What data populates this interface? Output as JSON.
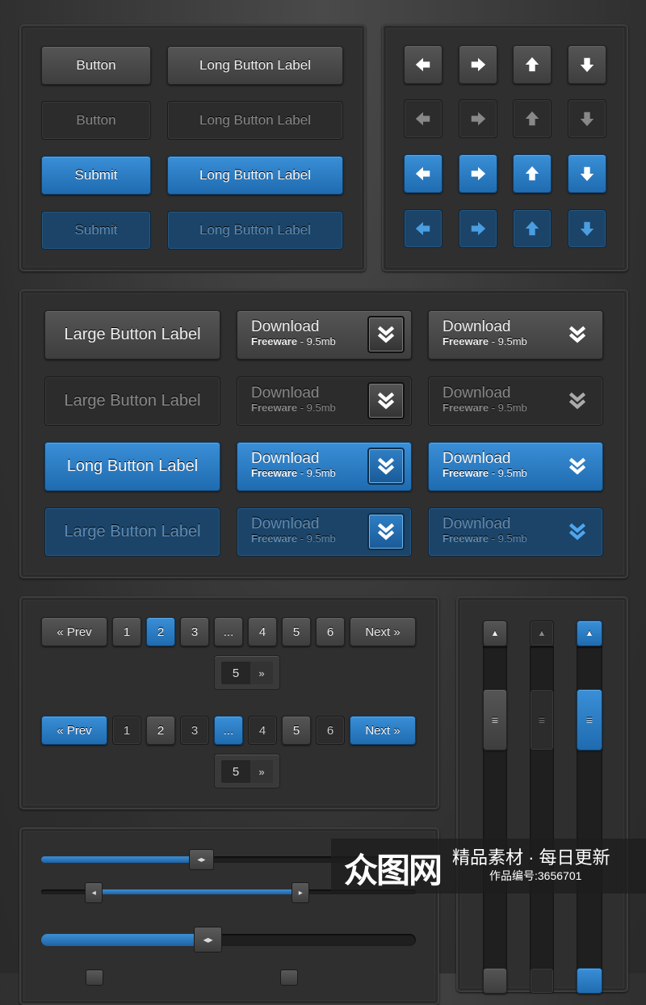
{
  "colors": {
    "accent": "#2a7cc4",
    "panel": "#2f2f2f",
    "background": "#2a2a2a"
  },
  "basic_buttons": [
    {
      "short": "Button",
      "long": "Long Button Label",
      "style": "g"
    },
    {
      "short": "Button",
      "long": "Long Button Label",
      "style": "gd"
    },
    {
      "short": "Submit",
      "long": "Long Button Label",
      "style": "b"
    },
    {
      "short": "Submit",
      "long": "Long Button Label",
      "style": "bd"
    }
  ],
  "arrow_buttons": {
    "icons": [
      "arrow-left-icon",
      "arrow-right-icon",
      "arrow-up-icon",
      "arrow-down-icon"
    ],
    "row_styles": [
      "g",
      "gd",
      "b",
      "bd"
    ]
  },
  "large_buttons": [
    {
      "label": "Large Button Label",
      "style": "g"
    },
    {
      "label": "Large Button Label",
      "style": "gd"
    },
    {
      "label": "Long Button Label",
      "style": "b"
    },
    {
      "label": "Large Button Label",
      "style": "bd"
    }
  ],
  "download_button": {
    "title": "Download",
    "subtitle_bold": "Freeware",
    "subtitle_rest": " - 9.5mb",
    "icon": "double-chevron-down-icon"
  },
  "pagination": [
    {
      "prev": "« Prev",
      "next": "Next »",
      "pages": [
        "1",
        "2",
        "3",
        "...",
        "4",
        "5",
        "6"
      ],
      "active": "2",
      "nav_style": "g",
      "popup_value": "5",
      "popup_go": "»"
    },
    {
      "prev": "« Prev",
      "next": "Next »",
      "pages": [
        "1",
        "2",
        "3",
        "...",
        "4",
        "5",
        "6"
      ],
      "active": "...",
      "nav_style": "b",
      "popup_value": "5",
      "popup_go": "»"
    }
  ],
  "scrollbars": [
    {
      "style": "g",
      "thumb_position": 0.15
    },
    {
      "style": "gd",
      "thumb_position": 0.15
    },
    {
      "style": "b",
      "thumb_position": 0.15
    }
  ],
  "sliders": [
    {
      "type": "single",
      "value": 0.42
    },
    {
      "type": "range",
      "low": 0.13,
      "high": 0.66
    },
    {
      "type": "single",
      "value": 0.44
    }
  ],
  "watermark": {
    "logo": "众图网",
    "slogan": "精品素材 · 每日更新",
    "code": "作品编号:3656701"
  }
}
